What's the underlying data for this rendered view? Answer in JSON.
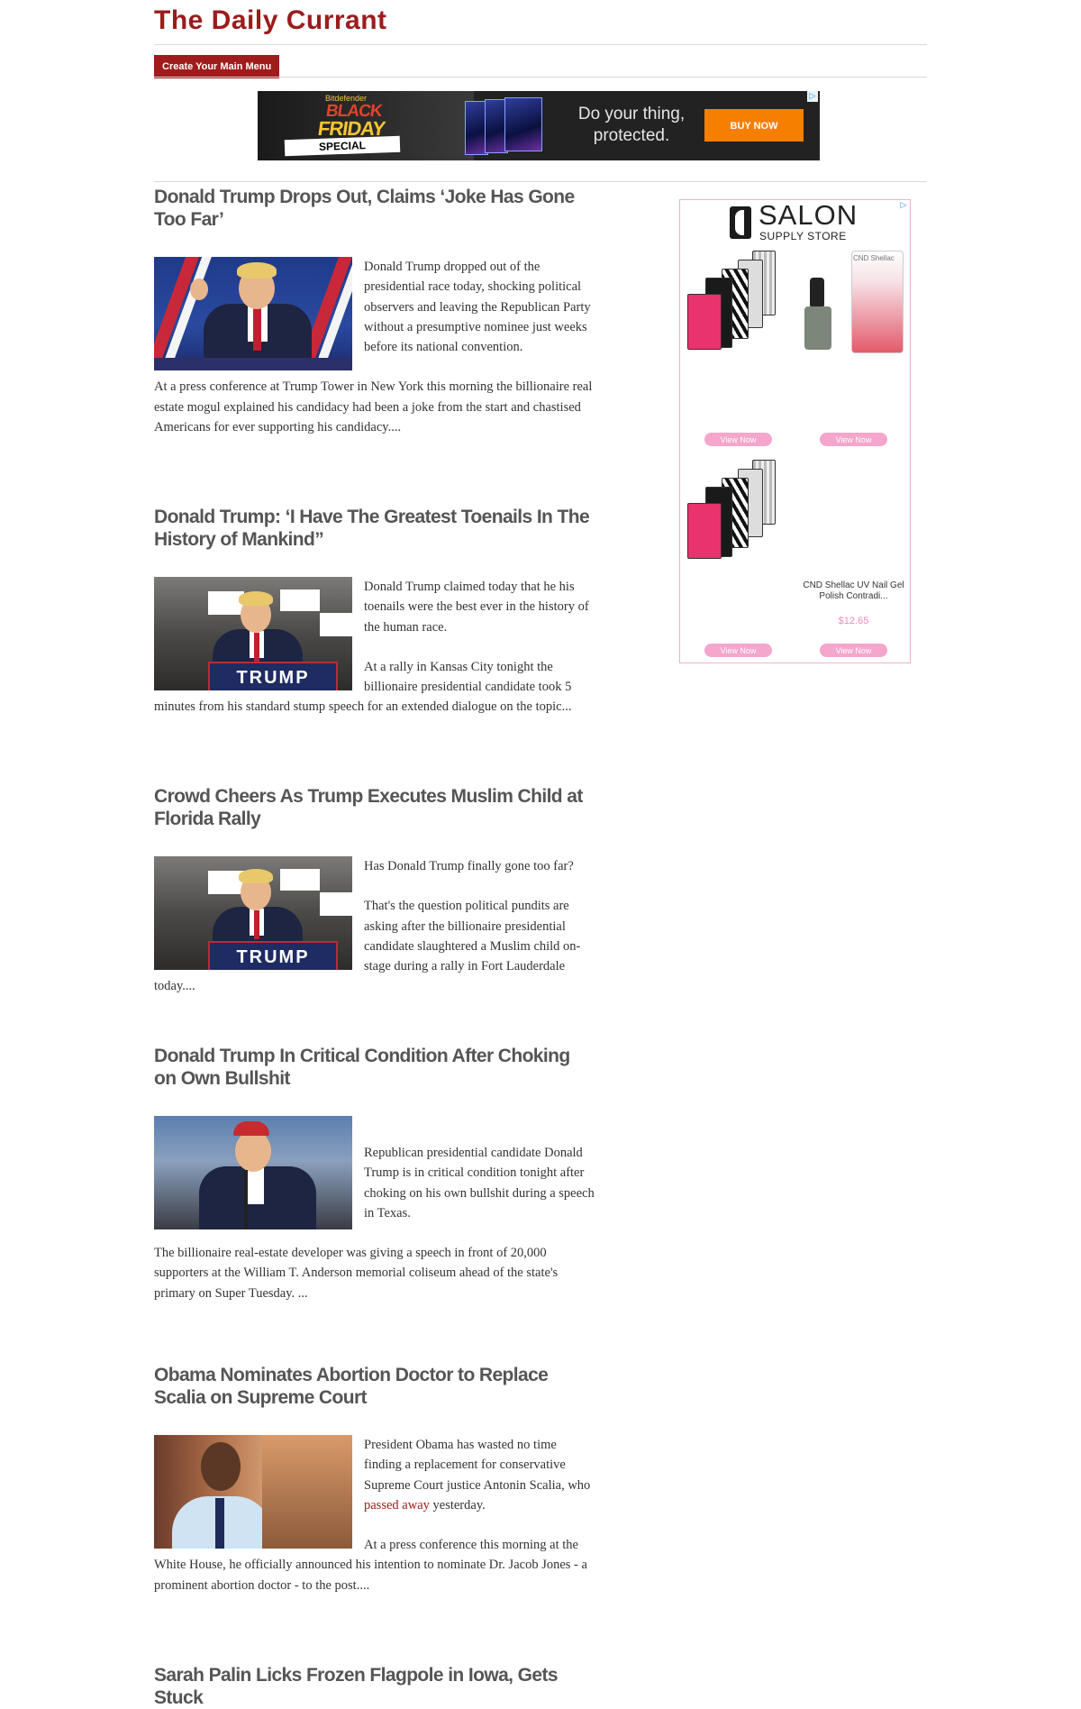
{
  "site": {
    "title": "The Daily Currant",
    "menu_button": "Create Your Main Menu"
  },
  "banner_ad": {
    "brand": "Bitdefender",
    "black": "BLACK",
    "friday": "FRIDAY",
    "special": "SPECIAL",
    "tagline": "Do your thing, protected.",
    "cta": "BUY NOW",
    "adchoice_icon": "adchoices-icon"
  },
  "articles": [
    {
      "title": "Donald Trump Drops Out, Claims ‘Joke Has Gone Too Far’",
      "paragraphs": [
        "Donald Trump dropped out of the presidential race today, shocking political observers and leaving the Republican Party without a presumptive nominee just weeks before its national convention.",
        "At a press conference at Trump Tower in New York this morning the billionaire real estate mogul explained his candidacy had been a joke from the start and chastised Americans for ever supporting his candidacy...."
      ]
    },
    {
      "title": "Donald Trump: ‘I Have The Greatest Toenails In The History of Mankind”",
      "paragraphs": [
        "Donald Trump claimed today that he his toenails were the best ever in the history of the human race.",
        "At a rally in Kansas City tonight the billionaire presidential candidate took 5 minutes from his standard stump speech for an extended dialogue on the topic..."
      ],
      "podium_text": "TRUMP"
    },
    {
      "title": "Crowd Cheers As Trump Executes Muslim Child at Florida Rally",
      "paragraphs": [
        "Has Donald Trump finally gone too far?",
        "That's the question political pundits are asking after the billionaire presidential candidate slaughtered a Muslim child on-stage during a rally in Fort Lauderdale today...."
      ],
      "podium_text": "TRUMP"
    },
    {
      "title": "Donald Trump In Critical Condition After Choking on Own Bullshit",
      "paragraphs": [
        "Republican presidential candidate Donald Trump is in critical condition tonight after choking on his own bullshit during a speech in Texas.",
        "The billionaire real-estate developer was giving a speech in front of 20,000 supporters at the William T. Anderson memorial coliseum ahead of the state's primary on Super Tuesday. ..."
      ]
    },
    {
      "title": "Obama Nominates Abortion Doctor to Replace Scalia on Supreme Court",
      "p1_before": "President Obama has wasted no time finding a replacement for conservative Supreme Court justice Antonin Scalia, who ",
      "p1_link": "passed away",
      "p1_after": " yesterday.",
      "p2": "At a press conference this morning at the White House, he officially announced his intention to nominate Dr. Jacob Jones - a prominent abortion doctor - to the post...."
    },
    {
      "title": "Sarah Palin Licks Frozen Flagpole in Iowa, Gets Stuck"
    }
  ],
  "sidebar_ad": {
    "brand": "SALON",
    "brand_sub": "SUPPLY STORE",
    "view_label": "View Now",
    "product_name": "CND Shellac UV Nail Gel Polish Contradi...",
    "product_price": "$12.65",
    "bottle_label": "CND Shellac",
    "adchoice_icon": "adchoices-icon"
  },
  "colors": {
    "brand_red": "#9b1c1c",
    "ad_pink": "#f4a6cc",
    "buy_orange": "#f77f00"
  }
}
